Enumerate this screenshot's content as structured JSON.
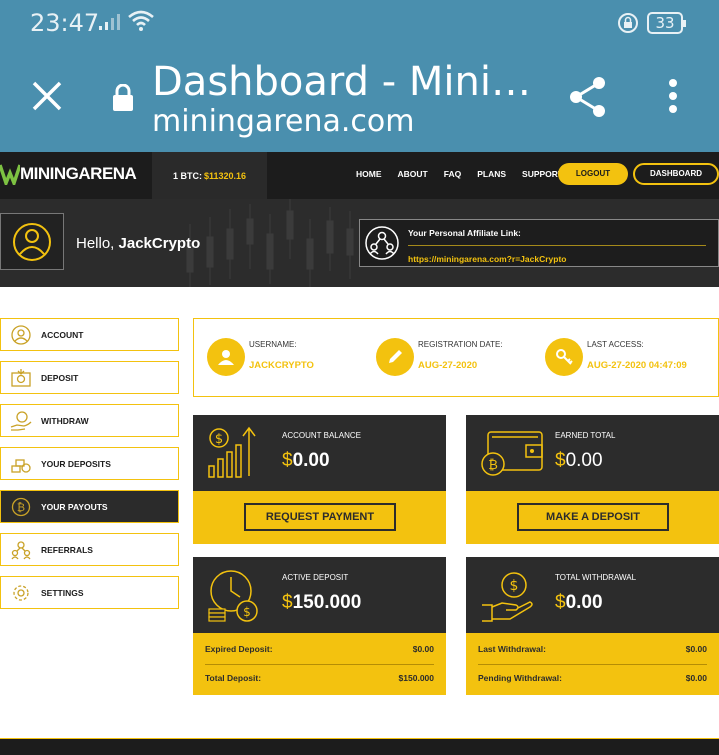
{
  "status_bar": {
    "time": "23:47",
    "battery": "33"
  },
  "browser": {
    "page_title": "Dashboard - Mini…",
    "domain": "miningarena.com"
  },
  "nav": {
    "logo": "MININGARENA",
    "btc_label": "1 BTC:",
    "btc_value": "$11320.16",
    "links": [
      "HOME",
      "ABOUT",
      "FAQ",
      "PLANS",
      "SUPPORT"
    ],
    "logout": "LOGOUT",
    "dashboard": "DASHBOARD"
  },
  "hero": {
    "hello": "Hello,",
    "username": "JackCrypto",
    "affiliate_label": "Your Personal Affiliate Link:",
    "affiliate_link": "https://miningarena.com?r=JackCrypto"
  },
  "sidebar": {
    "items": [
      {
        "label": "ACCOUNT",
        "icon": "user-icon"
      },
      {
        "label": "DEPOSIT",
        "icon": "deposit-icon"
      },
      {
        "label": "WITHDRAW",
        "icon": "withdraw-icon"
      },
      {
        "label": "YOUR DEPOSITS",
        "icon": "coins-icon"
      },
      {
        "label": "YOUR PAYOUTS",
        "icon": "bitcoin-icon"
      },
      {
        "label": "REFERRALS",
        "icon": "referrals-icon"
      },
      {
        "label": "SETTINGS",
        "icon": "gear-icon"
      }
    ],
    "active": "YOUR PAYOUTS"
  },
  "info": {
    "username_label": "USERNAME:",
    "username_value": "JACKCRYPTO",
    "reg_label": "REGISTRATION DATE:",
    "reg_value": "AUG-27-2020",
    "access_label": "LAST ACCESS:",
    "access_value": "AUG-27-2020 04:47:09"
  },
  "cards": {
    "balance": {
      "label": "ACCOUNT BALANCE",
      "currency": "$",
      "amount": "0.00",
      "button": "REQUEST PAYMENT"
    },
    "earned": {
      "label": "EARNED TOTAL",
      "currency": "$",
      "amount": "0.00",
      "button": "MAKE A DEPOSIT"
    },
    "active": {
      "label": "ACTIVE DEPOSIT",
      "currency": "$",
      "amount": "150.000",
      "row1_label": "Expired Deposit:",
      "row1_value": "$0.00",
      "row2_label": "Total Deposit:",
      "row2_value": "$150.000"
    },
    "withdrawal": {
      "label": "TOTAL WITHDRAWAL",
      "currency": "$",
      "amount": "0.00",
      "row1_label": "Last Withdrawal:",
      "row1_value": "$0.00",
      "row2_label": "Pending Withdrawal:",
      "row2_value": "$0.00"
    }
  },
  "colors": {
    "accent": "#f3c20f",
    "dark": "#2c2c2c",
    "browser": "#4a8fae"
  }
}
